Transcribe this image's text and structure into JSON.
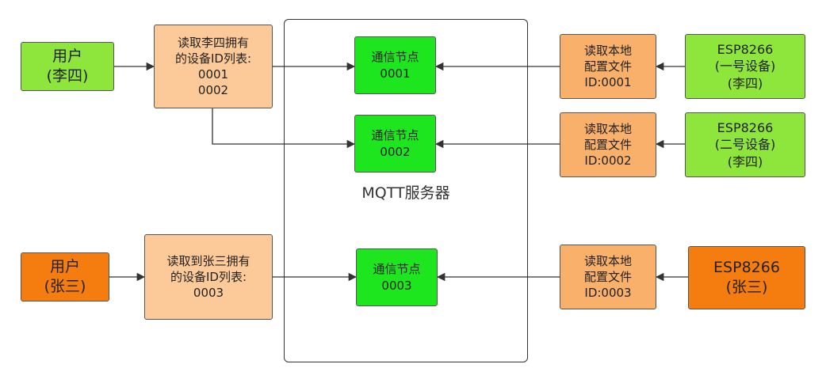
{
  "server": {
    "label": "MQTT服务器"
  },
  "users": [
    {
      "lines": [
        "用户",
        "(李四)"
      ],
      "color": "#8ee63c"
    },
    {
      "lines": [
        "用户",
        "(张三)"
      ],
      "color": "#f57c0f"
    }
  ],
  "device_lists": [
    {
      "lines": [
        "读取李四拥有",
        "的设备ID列表:",
        "0001",
        "0002"
      ]
    },
    {
      "lines": [
        "读取到张三拥有",
        "的设备ID列表:",
        "0003"
      ]
    }
  ],
  "mqtt_nodes": [
    {
      "lines": [
        "通信节点",
        "0001"
      ]
    },
    {
      "lines": [
        "通信节点",
        "0002"
      ]
    },
    {
      "lines": [
        "通信节点",
        "0003"
      ]
    }
  ],
  "config_files": [
    {
      "lines": [
        "读取本地",
        "配置文件",
        "ID:0001"
      ]
    },
    {
      "lines": [
        "读取本地",
        "配置文件",
        "ID:0002"
      ]
    },
    {
      "lines": [
        "读取本地",
        "配置文件",
        "ID:0003"
      ]
    }
  ],
  "devices": [
    {
      "lines": [
        "ESP8266",
        "(一号设备)",
        "(李四)"
      ],
      "color": "#8ee63c"
    },
    {
      "lines": [
        "ESP8266",
        "(二号设备)",
        "(李四)"
      ],
      "color": "#8ee63c"
    },
    {
      "lines": [
        "ESP8266",
        "(张三)"
      ],
      "color": "#f57c0f"
    }
  ],
  "colors": {
    "user_green": "#8ee63c",
    "user_orange": "#f57c0f",
    "list_box": "#fcc998",
    "config_box": "#f9b06b",
    "mqtt_node": "#1ee61e",
    "line": "#333333"
  }
}
